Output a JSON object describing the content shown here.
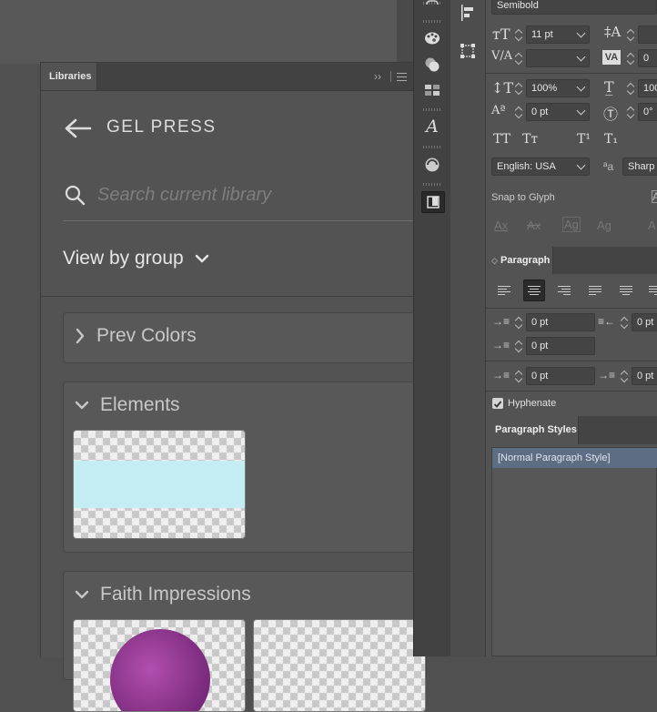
{
  "libraries": {
    "tab_label": "Libraries",
    "library_name": "GEL PRESS",
    "search_placeholder": "Search current library",
    "view_by_label": "View by group",
    "groups": [
      {
        "name": "Prev Colors",
        "expanded": false
      },
      {
        "name": "Elements",
        "expanded": true
      },
      {
        "name": "Faith Impressions",
        "expanded": true
      }
    ]
  },
  "character": {
    "font_style": "Semibold",
    "font_size": "11 pt",
    "leading": "",
    "kerning": "",
    "tracking": "0",
    "vertical_scale": "100%",
    "horizontal_scale": "100",
    "baseline_shift": "0 pt",
    "rotation": "0°",
    "language": "English: USA",
    "antialias": "Sharp",
    "snap_to_glyph_label": "Snap to Glyph"
  },
  "paragraph": {
    "tab_label": "Paragraph",
    "left_indent": "0 pt",
    "right_indent": "0 pt",
    "first_line_indent": "0 pt",
    "space_before": "0 pt",
    "space_after": "0 pt",
    "hyphenate_label": "Hyphenate",
    "hyphenate_checked": true
  },
  "paragraph_styles": {
    "tab_label": "Paragraph Styles",
    "items": [
      "[Normal Paragraph Style]"
    ]
  },
  "colors": {
    "panel_bg": "#535353",
    "selection": "#5c6d84",
    "thumb_blue": "#c4eef4"
  }
}
